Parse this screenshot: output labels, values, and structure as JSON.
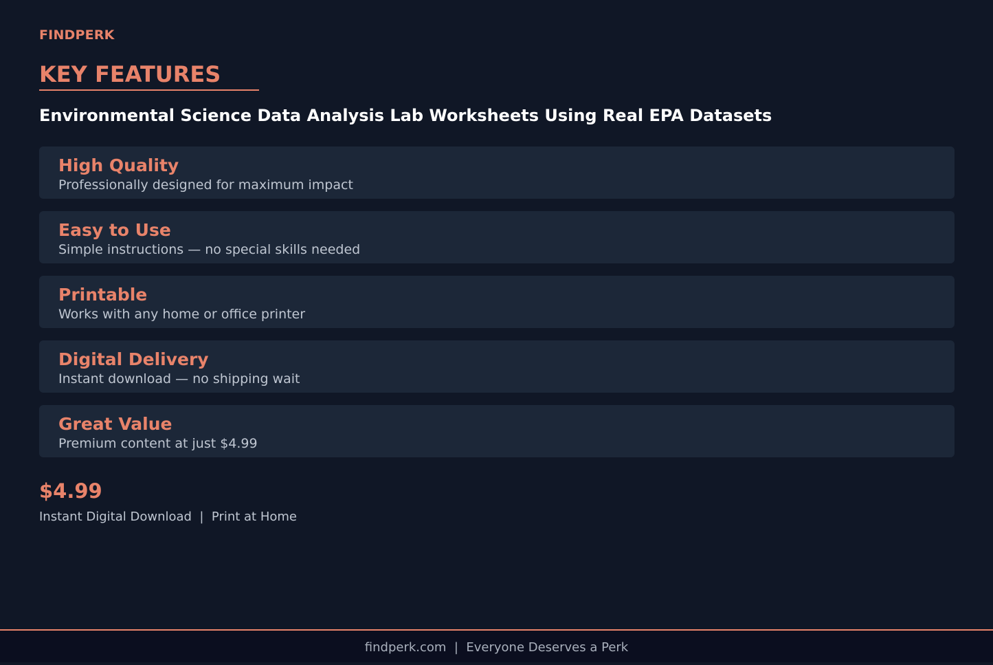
{
  "brand": "FINDPERK",
  "heading": "KEY FEATURES",
  "subtitle": "Environmental Science Data Analysis Lab Worksheets Using Real EPA Datasets",
  "features": [
    {
      "title": "High Quality",
      "desc": "Professionally designed for maximum impact"
    },
    {
      "title": "Easy to Use",
      "desc": "Simple instructions — no special skills needed"
    },
    {
      "title": "Printable",
      "desc": "Works with any home or office printer"
    },
    {
      "title": "Digital Delivery",
      "desc": "Instant download — no shipping wait"
    },
    {
      "title": "Great Value",
      "desc": "Premium content at just $4.99"
    }
  ],
  "price": "$4.99",
  "delivery": "Instant Digital Download  |  Print at Home",
  "footer": "findperk.com  |  Everyone Deserves a Perk",
  "colors": {
    "accent": "#E8836A",
    "background": "#101726",
    "card": "#1C2738",
    "footer_bg": "#0B0E1F"
  }
}
